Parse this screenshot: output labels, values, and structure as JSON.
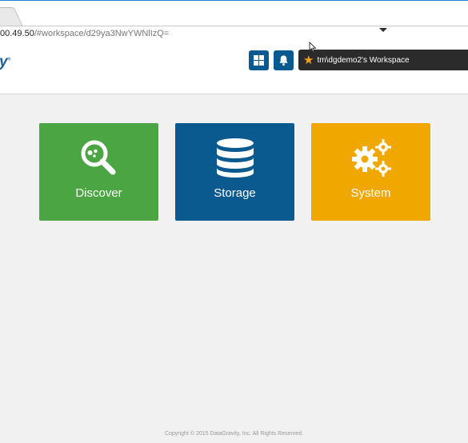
{
  "browser": {
    "url_host": "00.49.50",
    "url_path": "/#workspace/d29ya3NwYWNlIzQ="
  },
  "header": {
    "logo_fragment": "y",
    "workspace_label": "tm\\dgdemo2's Workspace",
    "grid_button_icon": "grid-icon",
    "bell_button_icon": "bell-icon",
    "star_icon": "star-icon"
  },
  "tiles": [
    {
      "label": "Discover",
      "icon": "magnifier-icon",
      "color": "#4aa542"
    },
    {
      "label": "Storage",
      "icon": "database-icon",
      "color": "#0a5a8f"
    },
    {
      "label": "System",
      "icon": "gears-icon",
      "color": "#f0a800"
    }
  ],
  "footer": {
    "copyright": "Copyright © 2015 DataGravity, Inc. All Rights Reserved."
  },
  "colors": {
    "header_button": "#0a5a92",
    "workspace_pill": "#2b2b2b",
    "star": "#f3a41a",
    "background": "#f1f1f1"
  }
}
